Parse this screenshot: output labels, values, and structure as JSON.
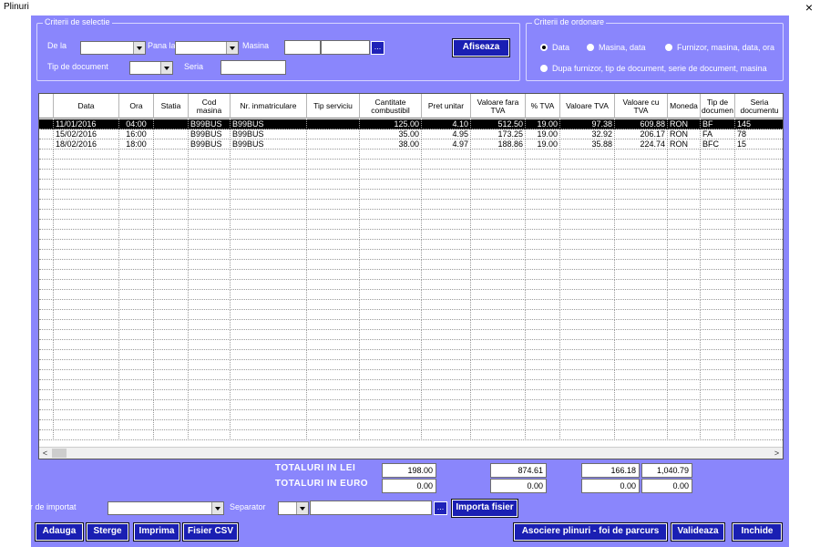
{
  "window": {
    "title": "Plinuri",
    "close_label": "×"
  },
  "selection": {
    "title": "Criterii de selectie",
    "from_label": "De la",
    "to_label": "Pana la",
    "vehicle_label": "Masina",
    "doctype_label": "Tip de document",
    "series_label": "Seria",
    "dots_label": "...",
    "show_button": "Afiseaza"
  },
  "ordering": {
    "title": "Criterii de ordonare",
    "options": [
      {
        "label": "Data",
        "selected": true
      },
      {
        "label": "Masina, data",
        "selected": false
      },
      {
        "label": "Furnizor, masina, data, ora",
        "selected": false
      },
      {
        "label": "Dupa furnizor, tip de document, serie de document, masina",
        "selected": false
      }
    ]
  },
  "table": {
    "columns": [
      "Data",
      "Ora",
      "Statia",
      "Cod masina",
      "Nr. inmatriculare",
      "Tip serviciu",
      "Cantitate combustibil",
      "Pret unitar",
      "Valoare fara TVA",
      "% TVA",
      "Valoare TVA",
      "Valoare cu TVA",
      "Moneda",
      "Tip de documen",
      "Seria documentu"
    ],
    "rows": [
      [
        "11/01/2016",
        "04:00",
        "",
        "B99BUS",
        "B99BUS",
        "",
        "125.00",
        "4.10",
        "512.50",
        "19.00",
        "97.38",
        "609.88",
        "RON",
        "BF",
        "145"
      ],
      [
        "15/02/2016",
        "16:00",
        "",
        "B99BUS",
        "B99BUS",
        "",
        "35.00",
        "4.95",
        "173.25",
        "19.00",
        "32.92",
        "206.17",
        "RON",
        "FA",
        "78"
      ],
      [
        "18/02/2016",
        "18:00",
        "",
        "B99BUS",
        "B99BUS",
        "",
        "38.00",
        "4.97",
        "188.86",
        "19.00",
        "35.88",
        "224.74",
        "RON",
        "BFC",
        "15"
      ]
    ],
    "selected_row": 0,
    "scroll_left": "<",
    "scroll_right": ">"
  },
  "totals": {
    "lei_label": "TOTALURI IN LEI",
    "euro_label": "TOTALURI IN EURO",
    "lei": {
      "quantity": "198.00",
      "value_no_vat": "874.61",
      "vat": "166.18",
      "value_with_vat": "1,040.79"
    },
    "euro": {
      "quantity": "0.00",
      "value_no_vat": "0.00",
      "vat": "0.00",
      "value_with_vat": "0.00"
    }
  },
  "import": {
    "file_label": "Fisier de importat",
    "separator_label": "Separator",
    "dots_label": "...",
    "import_button": "Importa fisier"
  },
  "buttons": {
    "add": "Adauga",
    "delete": "Sterge",
    "print": "Imprima",
    "csv": "Fisier CSV",
    "associate": "Asociere plinuri - foi de parcurs",
    "validate": "Valideaza",
    "close": "Inchide"
  }
}
